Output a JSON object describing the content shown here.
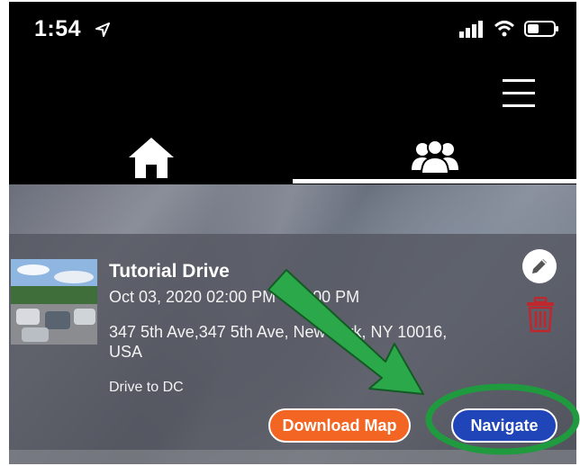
{
  "status": {
    "time": "1:54",
    "location_icon": "location-arrow-icon",
    "signal_icon": "cellular-signal-icon",
    "wifi_icon": "wifi-icon",
    "battery_icon": "battery-icon"
  },
  "header": {
    "menu_icon": "hamburger-menu-icon"
  },
  "tabs": [
    {
      "name": "home",
      "icon": "home-icon",
      "selected": false
    },
    {
      "name": "groups",
      "icon": "groups-icon",
      "selected": true
    }
  ],
  "drive": {
    "title": "Tutorial Drive",
    "date": "Oct 03, 2020 02:00 PM - 07:00 PM",
    "address": "347 5th Ave,347 5th Ave, New York, NY 10016, USA",
    "note": "Drive to DC",
    "download_label": "Download Map",
    "navigate_label": "Navigate"
  },
  "colors": {
    "download": "#f26522",
    "navigate": "#2045b8",
    "delete": "#c0272d",
    "annotation_arrow": "#2aa84a",
    "annotation_circle": "#1f9a3e"
  }
}
